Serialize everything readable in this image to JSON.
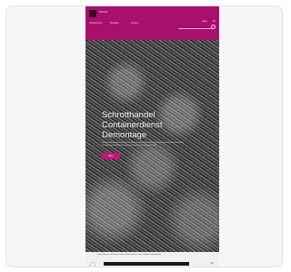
{
  "header": {
    "brand": "PRFM",
    "nav": [
      "Unternehmen",
      "Produkte",
      "Karriere"
    ],
    "utility": [
      "Login",
      "DE"
    ]
  },
  "hero": {
    "title": "Schrotthandel Containerdienst Demontage",
    "button": "Mehr"
  },
  "cookie": {
    "text": "Diese Website verwendet Cookies. Mehr erfahren in der Datenschutzerklärung.",
    "link": "Datenschutzerklärung",
    "ok": "OK"
  },
  "colors": {
    "brand": "#a8106e",
    "accent": "#d0107e"
  }
}
